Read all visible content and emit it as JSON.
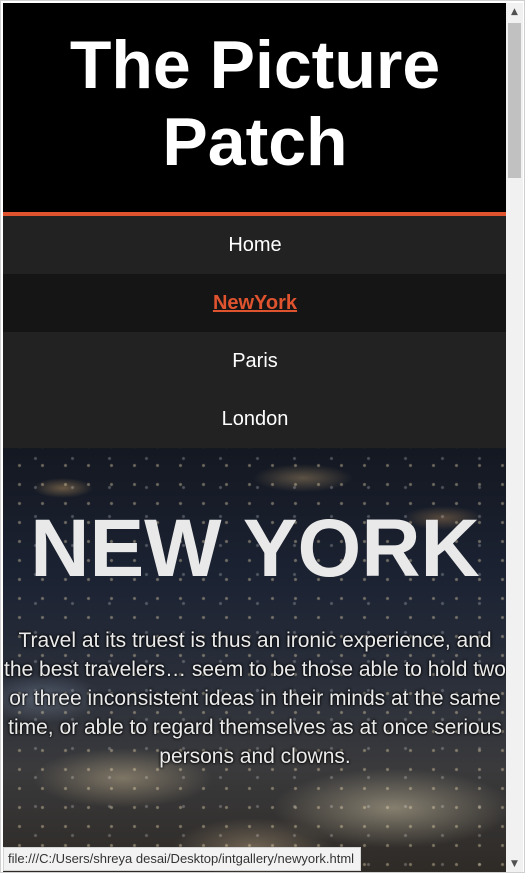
{
  "site": {
    "title": "The Picture Patch"
  },
  "nav": {
    "items": [
      {
        "label": "Home"
      },
      {
        "label": "NewYork"
      },
      {
        "label": "Paris"
      },
      {
        "label": "London"
      }
    ]
  },
  "hero": {
    "title": "NEW YORK",
    "quote": "Travel at its truest is thus an ironic experience, and the best travelers… seem to be those able to hold two or three inconsistent ideas in their minds at the same time, or able to regard themselves as at once serious persons and clowns."
  },
  "status_bar": {
    "url": "file:///C:/Users/shreya desai/Desktop/intgallery/newyork.html"
  },
  "colors": {
    "accent": "#e0532f",
    "header_bg": "#000000",
    "nav_bg": "#222222"
  },
  "icons": {
    "scroll_up": "scroll-up-arrow-icon",
    "scroll_down": "scroll-down-arrow-icon"
  }
}
